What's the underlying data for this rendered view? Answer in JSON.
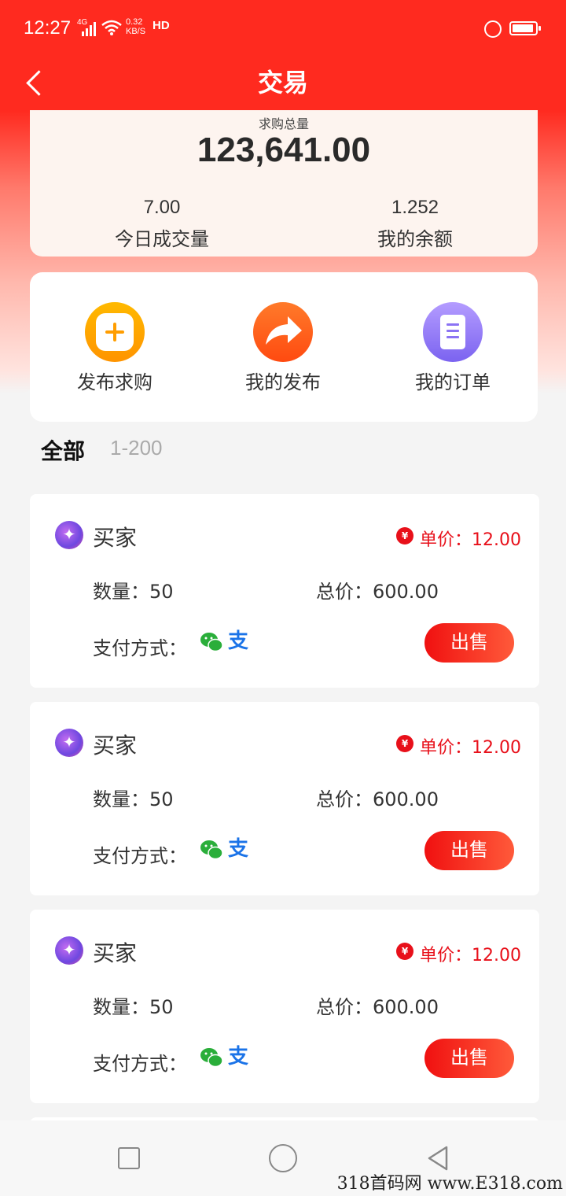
{
  "status_bar": {
    "time": "12:27",
    "network": "4G",
    "net_speed_value": "0.32",
    "net_speed_unit": "KB/S",
    "hd": "HD"
  },
  "header": {
    "title": "交易",
    "back_icon": "chevron-left-icon"
  },
  "summary": {
    "total_label": "求购总量",
    "total_value": "123,641.00",
    "today_value": "7.00",
    "today_label": "今日成交量",
    "balance_value": "1.252",
    "balance_label": "我的余额"
  },
  "actions": [
    {
      "label": "发布求购",
      "icon": "plus-square-icon",
      "color": "#ffa500"
    },
    {
      "label": "我的发布",
      "icon": "share-arrow-icon",
      "color": "#ff5a1a"
    },
    {
      "label": "我的订单",
      "icon": "document-list-icon",
      "color": "#8b73f4"
    }
  ],
  "tabs": {
    "all": "全部",
    "range": "1-200"
  },
  "orders": [
    {
      "buyer": "买家",
      "price": "单价：12.00",
      "quantity": "数量：50",
      "total": "总价：600.00",
      "payment_label": "支付方式：",
      "payment_methods": [
        "wechat-icon",
        "alipay-icon"
      ],
      "alipay_glyph": "支",
      "action": "出售"
    },
    {
      "buyer": "买家",
      "price": "单价：12.00",
      "quantity": "数量：50",
      "total": "总价：600.00",
      "payment_label": "支付方式：",
      "payment_methods": [
        "wechat-icon",
        "alipay-icon"
      ],
      "alipay_glyph": "支",
      "action": "出售"
    },
    {
      "buyer": "买家",
      "price": "单价：12.00",
      "quantity": "数量：50",
      "total": "总价：600.00",
      "payment_label": "支付方式：",
      "payment_methods": [
        "wechat-icon",
        "alipay-icon"
      ],
      "alipay_glyph": "支",
      "action": "出售"
    }
  ],
  "price_icon_glyph": "¥",
  "watermark": "318首码网 www.E318.com",
  "colors": {
    "brand_red": "#ff2a1f",
    "price_red": "#e8101a",
    "wechat_green": "#2aae3a",
    "alipay_blue": "#1a73e8"
  }
}
